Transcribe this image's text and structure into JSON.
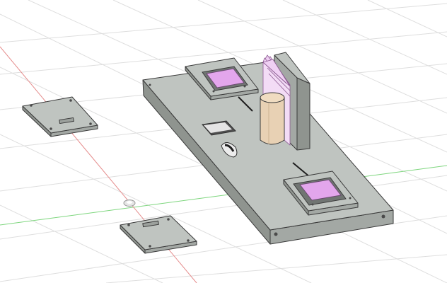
{
  "viewport": {
    "background": "#ffffff",
    "grid_color": "#dedede",
    "axis_x_color": "#e05a5a",
    "axis_y_color": "#5fc95f"
  },
  "model": {
    "base_plate_color": "#bfc4c0",
    "board_color": "#a9aea9",
    "screen_color": "#e3a6ec",
    "cylinder_color": "#e8d1b4",
    "icon": "origin-marker-icon"
  }
}
